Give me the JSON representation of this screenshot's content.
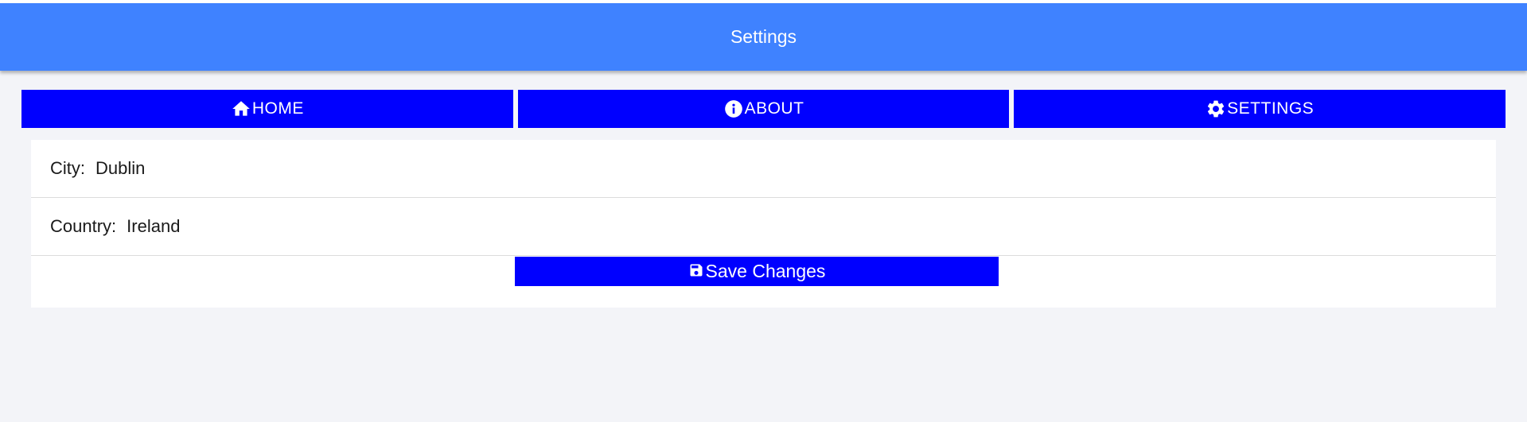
{
  "toolbar": {
    "title": "Settings",
    "color": "#3f82ff"
  },
  "tabs": [
    {
      "label": "HOME",
      "icon": "home-icon"
    },
    {
      "label": "ABOUT",
      "icon": "info-icon"
    },
    {
      "label": "SETTINGS",
      "icon": "gear-icon"
    }
  ],
  "settings": {
    "city": {
      "label": "City:",
      "value": "Dublin"
    },
    "country": {
      "label": "Country:",
      "value": "Ireland"
    }
  },
  "save_button": {
    "label": "Save Changes",
    "icon": "save-icon"
  },
  "colors": {
    "tab_background": "#0000ff",
    "page_background": "#f3f4f8"
  }
}
